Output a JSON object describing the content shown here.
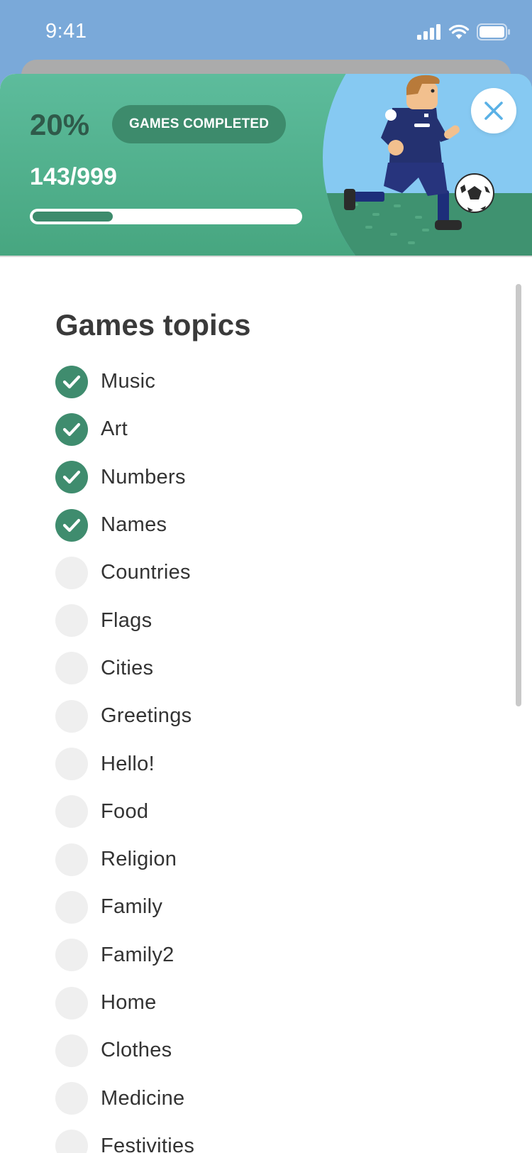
{
  "status_bar": {
    "time": "9:41"
  },
  "banner": {
    "percent": "20%",
    "badge": "GAMES COMPLETED",
    "count": "143/999",
    "progress": 0.3
  },
  "topics": {
    "title": "Games topics",
    "items": [
      {
        "label": "Music",
        "done": true
      },
      {
        "label": "Art",
        "done": true
      },
      {
        "label": "Numbers",
        "done": true
      },
      {
        "label": "Names",
        "done": true
      },
      {
        "label": "Countries",
        "done": false
      },
      {
        "label": "Flags",
        "done": false
      },
      {
        "label": "Cities",
        "done": false
      },
      {
        "label": "Greetings",
        "done": false
      },
      {
        "label": "Hello!",
        "done": false
      },
      {
        "label": "Food",
        "done": false
      },
      {
        "label": "Religion",
        "done": false
      },
      {
        "label": "Family",
        "done": false
      },
      {
        "label": "Family2",
        "done": false
      },
      {
        "label": "Home",
        "done": false
      },
      {
        "label": "Clothes",
        "done": false
      },
      {
        "label": "Medicine",
        "done": false
      },
      {
        "label": "Festivities",
        "done": false
      }
    ]
  },
  "colors": {
    "banner_green": "#5dbc9c",
    "accent_dark_green": "#3d8b6c",
    "unchecked_gray": "#efefef"
  },
  "icons": [
    "signal-icon",
    "wifi-icon",
    "battery-icon",
    "close-icon",
    "check-icon"
  ]
}
